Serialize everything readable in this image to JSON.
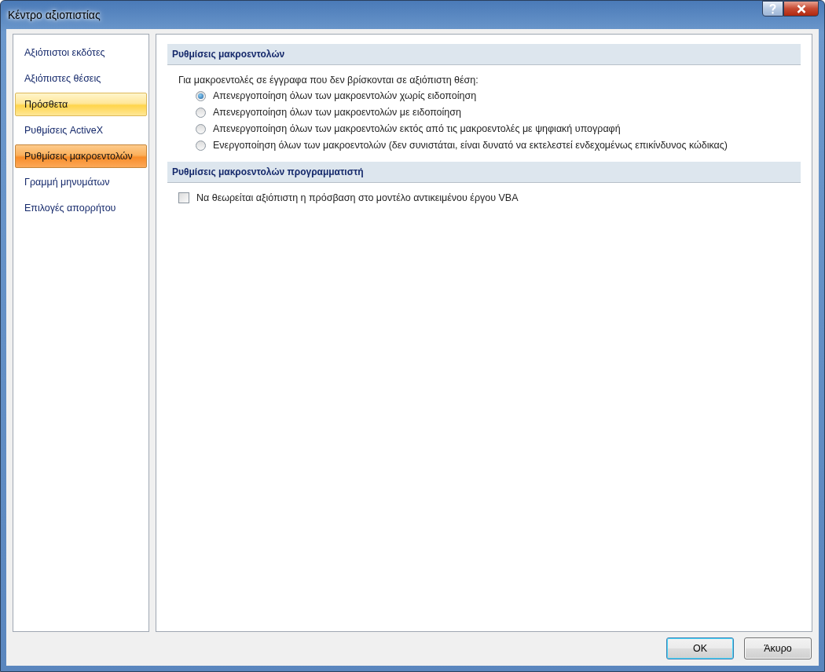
{
  "window": {
    "title": "Κέντρο αξιοπιστίας"
  },
  "sidebar": {
    "items": [
      {
        "label": "Αξιόπιστοι εκδότες",
        "selected": false,
        "hover": false
      },
      {
        "label": "Αξιόπιστες θέσεις",
        "selected": false,
        "hover": false
      },
      {
        "label": "Πρόσθετα",
        "selected": false,
        "hover": true
      },
      {
        "label": "Ρυθμίσεις ActiveX",
        "selected": false,
        "hover": false
      },
      {
        "label": "Ρυθμίσεις μακροεντολών",
        "selected": true,
        "hover": false
      },
      {
        "label": "Γραμμή μηνυμάτων",
        "selected": false,
        "hover": false
      },
      {
        "label": "Επιλογές απορρήτου",
        "selected": false,
        "hover": false
      }
    ]
  },
  "sections": [
    {
      "title": "Ρυθμίσεις μακροεντολών",
      "intro": "Για μακροεντολές σε έγγραφα που δεν βρίσκονται σε αξιόπιστη θέση:",
      "options": [
        {
          "kind": "radio",
          "label": "Απενεργοποίηση όλων των μακροεντολών χωρίς ειδοποίηση",
          "selected": true
        },
        {
          "kind": "radio",
          "label": "Απενεργοποίηση όλων των μακροεντολών με ειδοποίηση",
          "selected": false
        },
        {
          "kind": "radio",
          "label": "Απενεργοποίηση όλων των μακροεντολών εκτός από τις μακροεντολές με ψηφιακή υπογραφή",
          "selected": false
        },
        {
          "kind": "radio",
          "label": "Ενεργοποίηση όλων των μακροεντολών (δεν συνιστάται, είναι δυνατό να εκτελεστεί ενδεχομένως επικίνδυνος κώδικας)",
          "selected": false
        }
      ]
    },
    {
      "title": "Ρυθμίσεις μακροεντολών προγραμματιστή",
      "options": [
        {
          "kind": "checkbox",
          "label": "Να θεωρείται αξιόπιστη η πρόσβαση στο μοντέλο αντικειμένου έργου VBA",
          "checked": false
        }
      ]
    }
  ],
  "buttons": [
    {
      "label": "OK",
      "default": true
    },
    {
      "label": "Άκυρο",
      "default": false
    }
  ]
}
